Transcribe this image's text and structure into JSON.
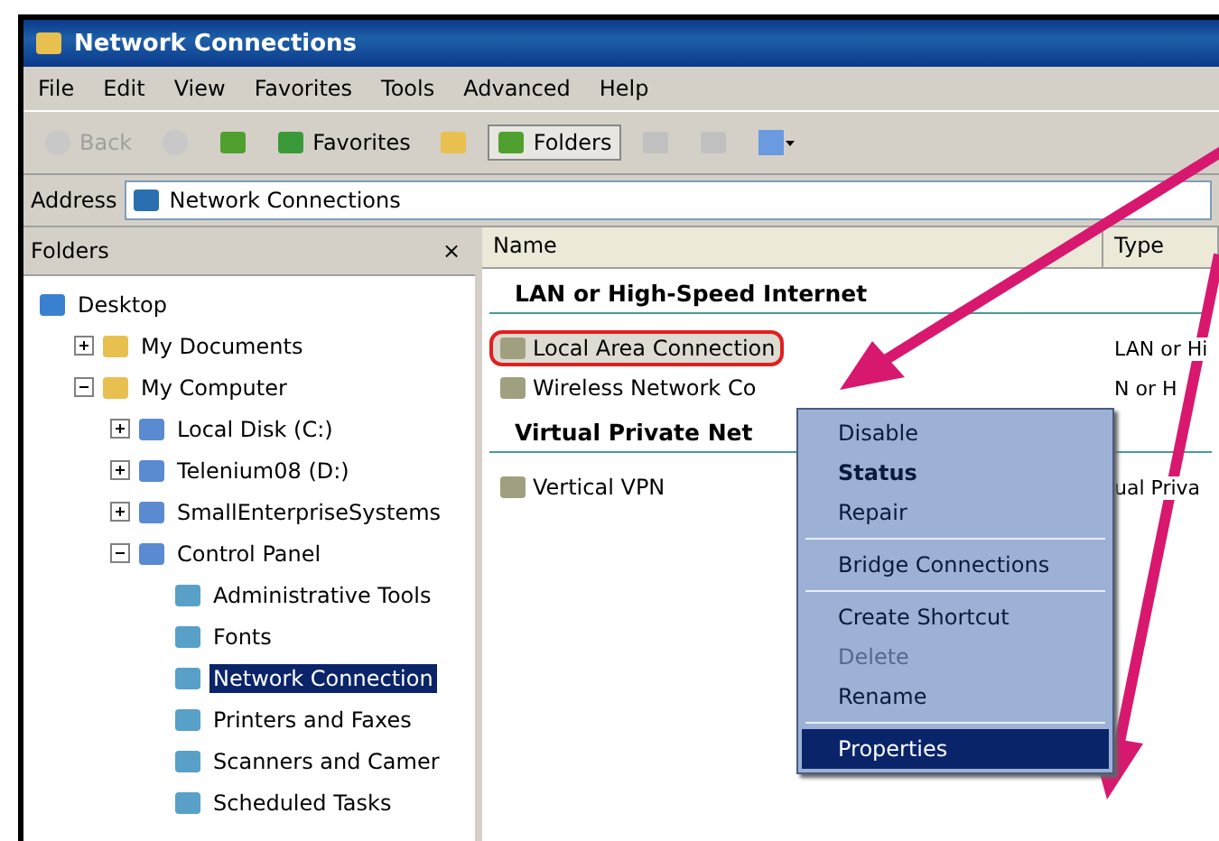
{
  "window": {
    "title": "Network Connections"
  },
  "menu": [
    "File",
    "Edit",
    "View",
    "Favorites",
    "Tools",
    "Advanced",
    "Help"
  ],
  "toolbar": [
    {
      "kind": "nav",
      "label": "Back",
      "disabled": true
    },
    {
      "kind": "nav",
      "disabled": true
    },
    {
      "kind": "icon",
      "disabled": false
    },
    {
      "kind": "text",
      "label": "Favorites",
      "disabled": false,
      "selected": false
    },
    {
      "kind": "icon",
      "disabled": false
    },
    {
      "kind": "text",
      "label": "Folders",
      "disabled": false,
      "selected": true
    },
    {
      "kind": "icon",
      "disabled": true
    },
    {
      "kind": "icon",
      "disabled": true
    },
    {
      "kind": "views",
      "disabled": false
    }
  ],
  "address": {
    "label": "Address",
    "value": "Network Connections"
  },
  "folders": {
    "title": "Folders",
    "close": "×",
    "tree": [
      {
        "label": "Desktop",
        "selected": false,
        "children": [
          {
            "label": "My Documents",
            "expanded": false,
            "selected": false
          },
          {
            "label": "My Computer",
            "expanded": true,
            "selected": false,
            "children": [
              {
                "label": "Local Disk (C:)",
                "expanded": false,
                "selected": false
              },
              {
                "label": "Telenium08 (D:)",
                "expanded": false,
                "selected": false
              },
              {
                "label": "SmallEnterpriseSystems",
                "expanded": false,
                "selected": false
              },
              {
                "label": "Control Panel",
                "expanded": true,
                "selected": false,
                "children": [
                  {
                    "label": "Administrative Tools",
                    "selected": false
                  },
                  {
                    "label": "Fonts",
                    "selected": false
                  },
                  {
                    "label": "Network Connection",
                    "selected": true
                  },
                  {
                    "label": "Printers and Faxes",
                    "selected": false
                  },
                  {
                    "label": "Scanners and Camer",
                    "selected": false
                  },
                  {
                    "label": "Scheduled Tasks",
                    "selected": false
                  }
                ]
              }
            ]
          }
        ]
      }
    ]
  },
  "list": {
    "columns": [
      "Name",
      "Type"
    ],
    "groups": [
      {
        "title": "LAN or High-Speed Internet",
        "items": [
          {
            "name": "Local Area Connection",
            "type": "LAN or Hi",
            "highlighted": true
          },
          {
            "name": "Wireless Network Co",
            "type": "N or H",
            "highlighted": false
          }
        ]
      },
      {
        "title": "Virtual Private Net",
        "items": [
          {
            "name": "Vertical VPN",
            "type": "ual Priva",
            "highlighted": false
          }
        ]
      }
    ]
  },
  "context_menu": [
    {
      "kind": "item",
      "label": "Disable",
      "bold": false,
      "disabled": false,
      "selected": false
    },
    {
      "kind": "item",
      "label": "Status",
      "bold": true,
      "disabled": false,
      "selected": false
    },
    {
      "kind": "item",
      "label": "Repair",
      "bold": false,
      "disabled": false,
      "selected": false
    },
    {
      "kind": "separator"
    },
    {
      "kind": "item",
      "label": "Bridge Connections",
      "bold": false,
      "disabled": false,
      "selected": false
    },
    {
      "kind": "separator"
    },
    {
      "kind": "item",
      "label": "Create Shortcut",
      "bold": false,
      "disabled": false,
      "selected": false
    },
    {
      "kind": "item",
      "label": "Delete",
      "bold": false,
      "disabled": true,
      "selected": false
    },
    {
      "kind": "item",
      "label": "Rename",
      "bold": false,
      "disabled": false,
      "selected": false
    },
    {
      "kind": "separator"
    },
    {
      "kind": "item",
      "label": "Properties",
      "bold": false,
      "disabled": false,
      "selected": true
    }
  ]
}
